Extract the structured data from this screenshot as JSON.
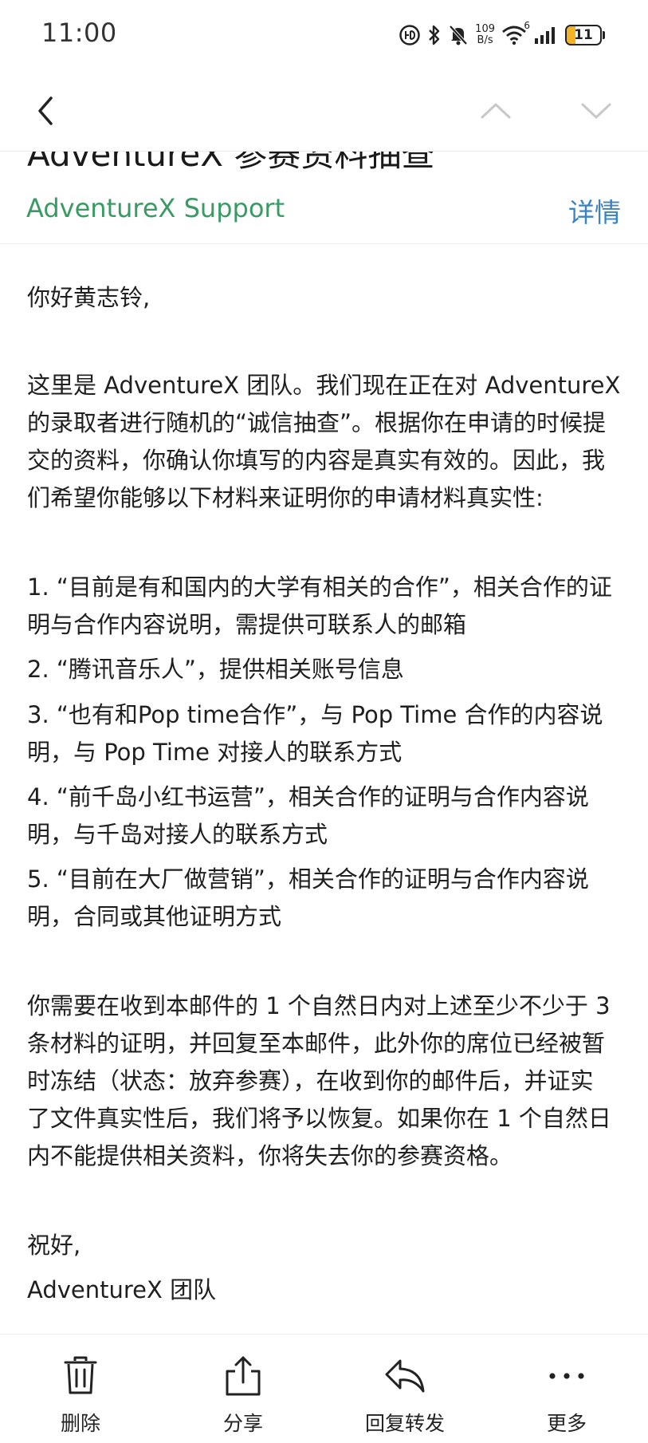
{
  "status_bar": {
    "time": "11:00",
    "net_speed_value": "109",
    "net_speed_unit": "B/s",
    "wifi_badge": "6",
    "battery_level": "11",
    "icons": [
      "hd-call-icon",
      "bluetooth-icon",
      "mute-bell-icon",
      "wifi-icon",
      "signal-icon",
      "battery-icon"
    ]
  },
  "nav": {
    "icons": [
      "back-chevron-icon",
      "previous-chevron-up-icon",
      "next-chevron-down-icon"
    ]
  },
  "email": {
    "subject": "AdventureX 参赛资料抽查",
    "sender": "AdventureX Support",
    "details_label": "详情",
    "greeting": "你好黄志铃,",
    "intro_lines": [
      "这里是 AdventureX 团队。我们现在正在对 AdventureX",
      "的录取者进行随机的“诚信抽查”。根据你在申请的时候提",
      "交的资料，你确认你填写的内容是真实有效的。因此，我",
      "们希望你能够以下材料来证明你的申请材料真实性:"
    ],
    "items": [
      [
        "1. “目前是有和国内的大学有相关的合作”，相关合作的证",
        "明与合作内容说明，需提供可联系人的邮箱"
      ],
      [
        "2. “腾讯音乐人”，提供相关账号信息"
      ],
      [
        "3. “也有和Pop time合作”，与 Pop Time 合作的内容说",
        "明，与 Pop Time 对接人的联系方式"
      ],
      [
        "4. “前千岛小红书运营”，相关合作的证明与合作内容说",
        "明，与千岛对接人的联系方式"
      ],
      [
        "5. “目前在大厂做营销”，相关合作的证明与合作内容说",
        "明，合同或其他证明方式"
      ]
    ],
    "notice_lines": [
      "你需要在收到本邮件的 1 个自然日内对上述至少不少于 3",
      "条材料的证明，并回复至本邮件，此外你的席位已经被暂",
      "时冻结（状态：放弃参赛），在收到你的邮件后，并证实",
      "了文件真实性后，我们将予以恢复。如果你在 1 个自然日",
      "内不能提供相关资料，你将失去你的参赛资格。"
    ],
    "closing": "祝好,",
    "signature": "AdventureX 团队"
  },
  "actions": [
    {
      "label": "删除",
      "icon": "trash-icon"
    },
    {
      "label": "分享",
      "icon": "share-icon"
    },
    {
      "label": "回复转发",
      "icon": "reply-icon"
    },
    {
      "label": "更多",
      "icon": "more-dots-icon"
    }
  ],
  "colors": {
    "sender": "#3a9a63",
    "details_link": "#3a83c4",
    "battery_fill": "#f3b324"
  }
}
